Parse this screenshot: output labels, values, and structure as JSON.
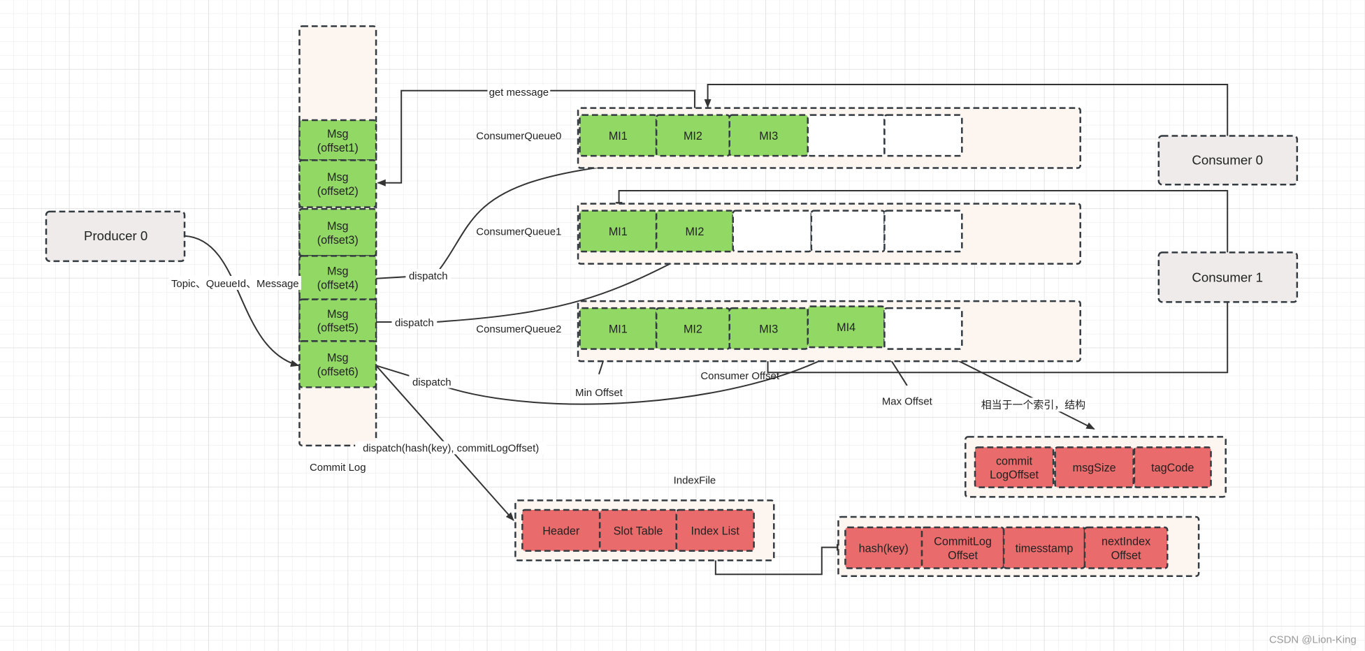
{
  "colors": {
    "green": "#92d865",
    "red": "#ea6b6b",
    "gray": "#eeebea",
    "container": "#fcf5f0",
    "stroke": "#333a40"
  },
  "producer": {
    "label": "Producer 0"
  },
  "consumers": [
    {
      "label": "Consumer 0"
    },
    {
      "label": "Consumer 1"
    }
  ],
  "commit_log": {
    "label": "Commit Log",
    "messages": [
      {
        "line1": "Msg",
        "line2": "(offset1)"
      },
      {
        "line1": "Msg",
        "line2": "(offset2)"
      },
      {
        "line1": "Msg",
        "line2": "(offset3)"
      },
      {
        "line1": "Msg",
        "line2": "(offset4)"
      },
      {
        "line1": "Msg",
        "line2": "(offset5)"
      },
      {
        "line1": "Msg",
        "line2": "(offset6)"
      }
    ]
  },
  "queues": [
    {
      "label": "ConsumerQueue0",
      "items": [
        "MI1",
        "MI2",
        "MI3"
      ]
    },
    {
      "label": "ConsumerQueue1",
      "items": [
        "MI1",
        "MI2"
      ]
    },
    {
      "label": "ConsumerQueue2",
      "items": [
        "MI1",
        "MI2",
        "MI3",
        "MI4"
      ]
    }
  ],
  "edges": {
    "send": "Topic、QueueId、Message",
    "get_message": "get message",
    "dispatch": "dispatch",
    "dispatch_index": "dispatch(hash(key), commitLogOffset)",
    "index_note": "相当于一个索引，结构"
  },
  "offsets": {
    "min": "Min Offset",
    "consumer": "Consumer Offset",
    "max": "Max Offset"
  },
  "cq_unit": {
    "fields": [
      {
        "line1": "commit",
        "line2": "LogOffset"
      },
      {
        "line1": "msgSize",
        "line2": ""
      },
      {
        "line1": "tagCode",
        "line2": ""
      }
    ]
  },
  "index_file": {
    "label": "IndexFile",
    "parts": [
      "Header",
      "Slot Table",
      "Index List"
    ],
    "entry": [
      {
        "line1": "hash(key)",
        "line2": ""
      },
      {
        "line1": "CommitLog",
        "line2": "Offset"
      },
      {
        "line1": "timesstamp",
        "line2": ""
      },
      {
        "line1": "nextIndex",
        "line2": "Offset"
      }
    ]
  },
  "watermark": "CSDN @Lion-King"
}
